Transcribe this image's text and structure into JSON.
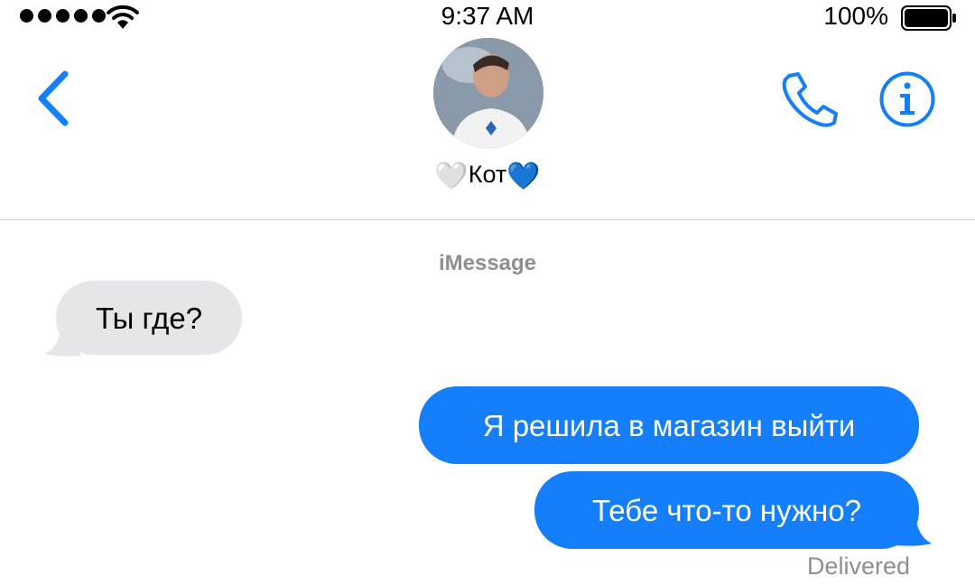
{
  "status_bar": {
    "time": "9:37 AM",
    "battery_percent": "100%",
    "battery_level": 1.0,
    "signal_bars": 5,
    "icons": [
      "signal-dots-icon",
      "wifi-icon",
      "battery-icon"
    ]
  },
  "header": {
    "back_icon": "chevron-left-icon",
    "contact": {
      "prefix_emoji": "🤍",
      "name": "Кот",
      "suffix_emoji": "💙"
    },
    "actions": [
      "phone-icon",
      "info-icon"
    ]
  },
  "conversation": {
    "service_label": "iMessage",
    "messages": [
      {
        "direction": "incoming",
        "text": "Ты где?"
      },
      {
        "direction": "outgoing",
        "text": "Я решила в магазин выйти"
      },
      {
        "direction": "outgoing",
        "text": "Тебе что-то нужно?"
      }
    ],
    "status": "Delivered"
  },
  "colors": {
    "accent": "#147efb",
    "incoming_bubble": "#e5e5ea",
    "secondary_text": "#8e8e93"
  }
}
